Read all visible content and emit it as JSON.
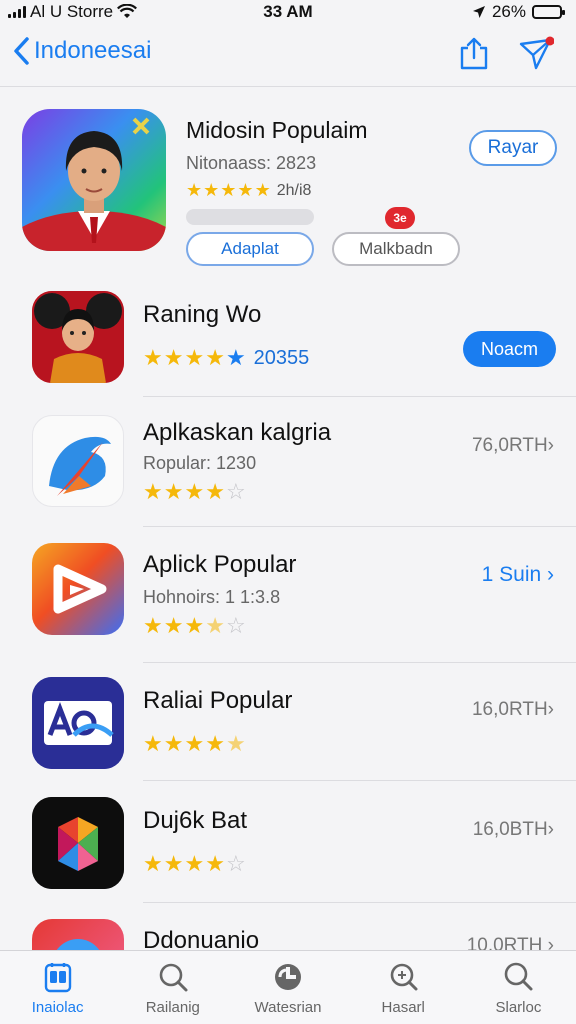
{
  "status_bar": {
    "carrier": "Al U Storre",
    "time": "33 AM",
    "battery": "26%",
    "battery_level": 0.26
  },
  "nav": {
    "back_label": "Indoneesai",
    "back_icon": "chevron-left-icon",
    "share_icon": "share-icon",
    "send_icon": "send-icon"
  },
  "featured": {
    "title": "Midosin Populaim",
    "subtitle": "Nitonaass: 2823",
    "rating_stars": 5,
    "rating_count": "2h/i8",
    "progress": 0.0,
    "badge": "3e",
    "button_left": "Adaplat",
    "button_right": "Malkbadn",
    "action_button": "Rayar"
  },
  "apps": [
    {
      "title": "Raning Wo",
      "rating": 5,
      "rating_count": "20355",
      "action_button": "Noacm"
    },
    {
      "title": "Aplkaskan kalgria",
      "subtitle": "Ropular: 1230",
      "rating": 4,
      "meta": "76,0RTH›"
    },
    {
      "title": "Aplick Popular",
      "subtitle": "Hohnoirs: 1 1:3.8",
      "rating": 3.5,
      "meta": "1 Suin ›"
    },
    {
      "title": "Raliai Popular",
      "rating": 4.5,
      "meta": "16,0RTH›"
    },
    {
      "title": "Duj6k Bat",
      "rating": 4,
      "meta": "16,0BTH›"
    },
    {
      "title": "Ddonuanio",
      "meta": "10,0RTH ›"
    }
  ],
  "tabs": [
    {
      "label": "Inaiolac",
      "icon": "apps-icon",
      "active": true
    },
    {
      "label": "Railanig",
      "icon": "search-icon",
      "active": false
    },
    {
      "label": "Watesrian",
      "icon": "games-icon",
      "active": false
    },
    {
      "label": "Hasarl",
      "icon": "search-icon",
      "active": false
    },
    {
      "label": "Slarloc",
      "icon": "search-icon",
      "active": false
    }
  ],
  "colors": {
    "accent": "#1a7df0",
    "star": "#f5b80a",
    "badge": "#e0282e"
  }
}
